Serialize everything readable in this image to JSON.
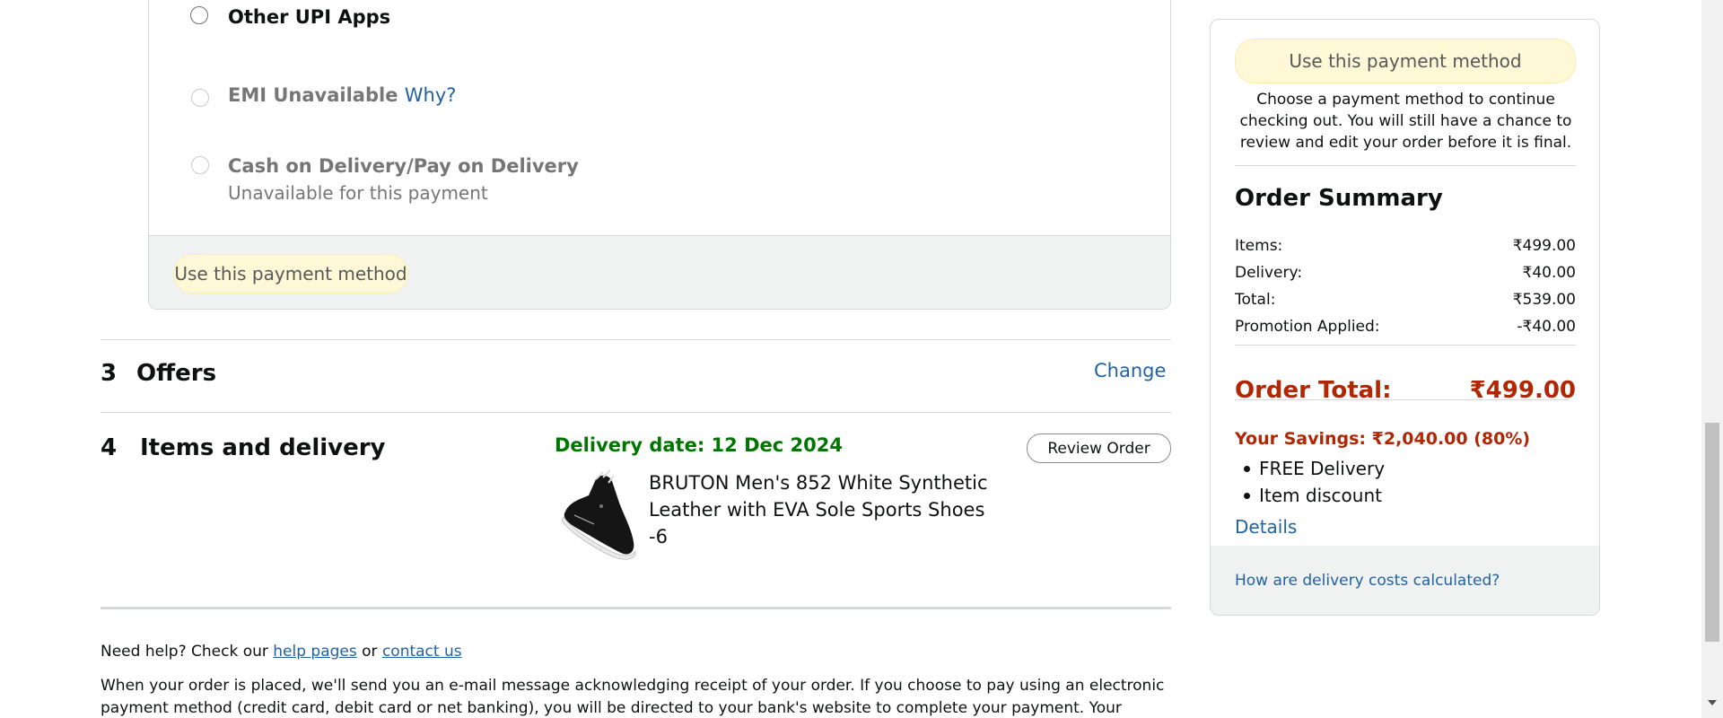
{
  "payment_options": {
    "other_upi": "Other UPI Apps",
    "emi": "EMI Unavailable",
    "emi_why": "Why?",
    "cod": "Cash on Delivery/Pay on Delivery",
    "cod_sub": "Unavailable for this payment",
    "use_button": "Use this payment method"
  },
  "offers": {
    "number": "3",
    "title": "Offers",
    "change": "Change"
  },
  "items_delivery": {
    "number": "4",
    "title": "Items and delivery",
    "delivery_date": "Delivery date: 12 Dec 2024",
    "review_button": "Review Order",
    "product_name": "BRUTON Men's 852 White Synthetic Leather with EVA Sole Sports Shoes -6"
  },
  "footer": {
    "help_prefix": "Need help? Check our",
    "help_pages": "help pages",
    "or": "or",
    "contact_us": "contact us",
    "notice": "When your order is placed, we'll send you an e-mail message acknowledging receipt of your order. If you choose to pay using an electronic payment method (credit card, debit card or net banking), you will be directed to your bank's website to complete your payment. Your contract to"
  },
  "summary": {
    "use_button": "Use this payment method",
    "note": "Choose a payment method to continue checking out. You will still have a chance to review and edit your order before it is final.",
    "title": "Order Summary",
    "rows": [
      {
        "label": "Items:",
        "value": "₹499.00"
      },
      {
        "label": "Delivery:",
        "value": "₹40.00"
      },
      {
        "label": "Total:",
        "value": "₹539.00"
      },
      {
        "label": "Promotion Applied:",
        "value": "-₹40.00"
      }
    ],
    "order_total_label": "Order Total:",
    "order_total_value": "₹499.00",
    "savings": "Your Savings: ₹2,040.00 (80%)",
    "benefits": [
      "FREE Delivery",
      "Item discount"
    ],
    "details": "Details",
    "delivery_costs_link": "How are delivery costs calculated?"
  },
  "colors": {
    "link": "#2162a1",
    "price_red": "#b12704",
    "delivery_green": "#007600",
    "button_yellow": "#fff8d7"
  }
}
